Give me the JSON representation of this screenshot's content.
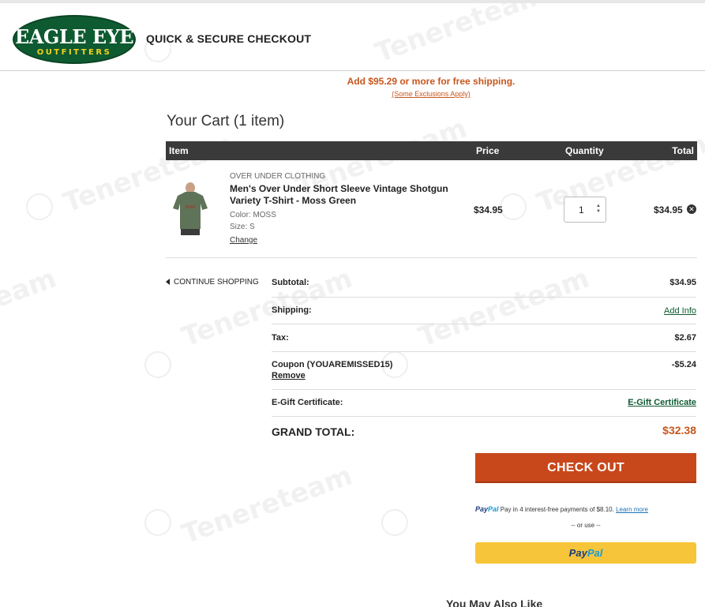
{
  "header": {
    "logo_top": "EAGLE EYE",
    "logo_bottom": "OUTFITTERS",
    "title": "QUICK & SECURE CHECKOUT"
  },
  "promo": {
    "text": "Add $95.29 or more for free shipping.",
    "sub": "(Some Exclusions Apply)"
  },
  "cart": {
    "title": "Your Cart (1 item)",
    "columns": {
      "item": "Item",
      "price": "Price",
      "quantity": "Quantity",
      "total": "Total"
    },
    "item": {
      "brand": "OVER UNDER CLOTHING",
      "name": "Men's Over Under Short Sleeve Vintage Shotgun Variety T-Shirt - Moss Green",
      "color": "Color: MOSS",
      "size": "Size: S",
      "change": "Change",
      "price": "$34.95",
      "quantity": "1",
      "total": "$34.95",
      "shirt_color": "#5f7358"
    }
  },
  "continue_shopping": "CONTINUE SHOPPING",
  "summary": {
    "subtotal_label": "Subtotal:",
    "subtotal_value": "$34.95",
    "shipping_label": "Shipping:",
    "shipping_link": "Add Info",
    "tax_label": "Tax:",
    "tax_value": "$2.67",
    "coupon_label": "Coupon (YOUAREMISSED15)",
    "coupon_remove": "Remove",
    "coupon_value": "-$5.24",
    "egift_label": "E-Gift Certificate:",
    "egift_link": "E-Gift Certificate",
    "grand_label": "GRAND TOTAL:",
    "grand_value": "$32.38"
  },
  "checkout_button": "CHECK OUT",
  "paypal": {
    "logo_a": "Pay",
    "logo_b": "Pal",
    "message": "Pay in 4 interest-free payments of $8.10.",
    "learn_more": "Learn more",
    "or_use": "-- or use --"
  },
  "bottom_heading": "You May Also Like",
  "watermark": "Tenereteam",
  "colors": {
    "brand_green": "#0e5a31",
    "accent_orange": "#c8561d",
    "checkout_orange": "#c8481b",
    "paypal_yellow": "#f7c53a"
  }
}
